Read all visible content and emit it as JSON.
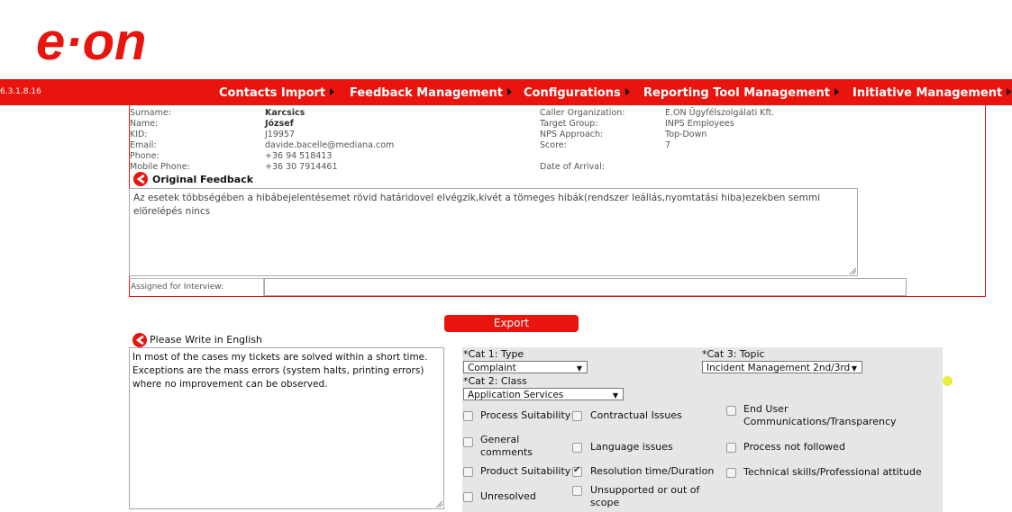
{
  "brand": {
    "accent": "#e8140d",
    "logo_text": "e·on"
  },
  "version": "6.3.1.8.16",
  "nav": [
    {
      "label": "Contacts Import"
    },
    {
      "label": "Feedback Management"
    },
    {
      "label": "Configurations"
    },
    {
      "label": "Reporting Tool Management"
    },
    {
      "label": "Initiative Management"
    }
  ],
  "contact": {
    "surname_label": "Surname:",
    "surname": "Karcsics",
    "name_label": "Name:",
    "name": "József",
    "kid_label": "KID:",
    "kid": "J19957",
    "email_label": "Email:",
    "email": "davide.bacelle@mediana.com",
    "phone_label": "Phone:",
    "phone": "+36 94 518413",
    "mobile_label": "Mobile Phone:",
    "mobile": "+36 30 7914461",
    "caller_org_label": "Caller Organization:",
    "caller_org": "E.ON Ügyfélszolgálati Kft.",
    "target_group_label": "Target Group:",
    "target_group": "INPS Employees",
    "nps_label": "NPS Approach:",
    "nps": "Top-Down",
    "score_label": "Score:",
    "score": "7",
    "arrival_label": "Date of Arrival:",
    "arrival": ""
  },
  "original_feedback": {
    "heading": "Original Feedback",
    "text": "Az esetek többségében a hibábejelentésemet rövid határidovel elvégzik,kivét a tömeges hibák(rendszer leállás,nyomtatási hiba)ezekben semmi elörelépés nincs"
  },
  "assigned": {
    "label": "Assigned for Interview:",
    "value": ""
  },
  "export_label": "Export",
  "english": {
    "heading": "Please Write in English",
    "text": "In most of the cases my tickets are solved within a short time. Exceptions are the mass errors (system halts, printing errors) where no improvement can be observed."
  },
  "categories": {
    "cat1_label": "*Cat 1: Type",
    "cat1_value": "Complaint",
    "cat2_label": "*Cat 2: Class",
    "cat2_value": "Application Services",
    "cat3_label": "*Cat 3: Topic",
    "cat3_value": "Incident Management 2nd/3rd"
  },
  "checkboxes": [
    {
      "label": "Process Suitability",
      "checked": false
    },
    {
      "label": "Contractual Issues",
      "checked": false
    },
    {
      "label": "End User Communications/Transparency",
      "checked": false
    },
    {
      "label": "General comments",
      "checked": false
    },
    {
      "label": "Language issues",
      "checked": false
    },
    {
      "label": "Process not followed",
      "checked": false
    },
    {
      "label": "Product Suitability",
      "checked": false
    },
    {
      "label": "Resolution time/Duration",
      "checked": true
    },
    {
      "label": "Technical skills/Professional attitude",
      "checked": false
    },
    {
      "label": "Unresolved",
      "checked": false
    },
    {
      "label": "Unsupported or out of scope",
      "checked": false
    }
  ]
}
